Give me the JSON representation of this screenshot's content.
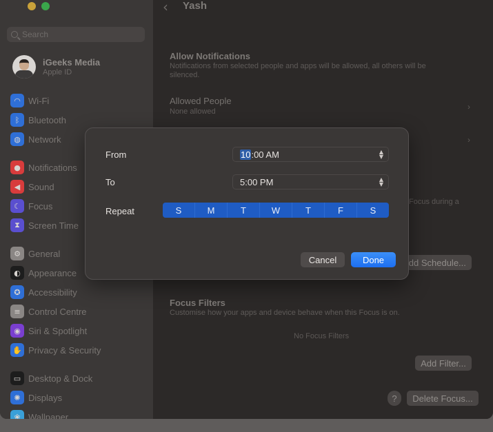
{
  "window": {
    "title": "Yash",
    "back_glyph": "‹"
  },
  "sidebar": {
    "search_placeholder": "Search",
    "account": {
      "name": "iGeeks Media",
      "subtitle": "Apple ID"
    },
    "items": [
      {
        "label": "Wi-Fi",
        "icon": "wifi-icon",
        "glyph": "◠",
        "color": "#2f6fd6"
      },
      {
        "label": "Bluetooth",
        "icon": "bluetooth-icon",
        "glyph": "ᛒ",
        "color": "#2f6fd6"
      },
      {
        "label": "Network",
        "icon": "globe-icon",
        "glyph": "◍",
        "color": "#2f6fd6"
      },
      {
        "label": "Notifications",
        "icon": "bell-icon",
        "glyph": "●",
        "color": "#d83c3c"
      },
      {
        "label": "Sound",
        "icon": "speaker-icon",
        "glyph": "◀",
        "color": "#d83c3c"
      },
      {
        "label": "Focus",
        "icon": "moon-icon",
        "glyph": "☾",
        "color": "#5a4fcf"
      },
      {
        "label": "Screen Time",
        "icon": "hourglass-icon",
        "glyph": "⧗",
        "color": "#5a4fcf"
      },
      {
        "label": "General",
        "icon": "gear-icon",
        "glyph": "⚙",
        "color": "#8a8684"
      },
      {
        "label": "Appearance",
        "icon": "appearance-icon",
        "glyph": "◐",
        "color": "#1d1d1d"
      },
      {
        "label": "Accessibility",
        "icon": "accessibility-icon",
        "glyph": "✪",
        "color": "#2f6fd6"
      },
      {
        "label": "Control Centre",
        "icon": "toggles-icon",
        "glyph": "≡",
        "color": "#8a8684"
      },
      {
        "label": "Siri & Spotlight",
        "icon": "siri-icon",
        "glyph": "◉",
        "color": "#7a3fd0"
      },
      {
        "label": "Privacy & Security",
        "icon": "hand-icon",
        "glyph": "✋",
        "color": "#2f6fd6"
      },
      {
        "label": "Desktop & Dock",
        "icon": "dock-icon",
        "glyph": "▭",
        "color": "#1d1d1d"
      },
      {
        "label": "Displays",
        "icon": "sun-icon",
        "glyph": "✺",
        "color": "#2f6fd6"
      },
      {
        "label": "Wallpaper",
        "icon": "wallpaper-icon",
        "glyph": "❀",
        "color": "#3aa0d8"
      }
    ]
  },
  "main": {
    "allow_notifications": {
      "title": "Allow Notifications",
      "subtitle": "Notifications from selected people and apps will be allowed, all others will be silenced."
    },
    "allowed_people": {
      "title": "Allowed People",
      "subtitle": "None allowed"
    },
    "partial_text": "Focus during a",
    "add_schedule_label": "Add Schedule...",
    "focus_filters": {
      "title": "Focus Filters",
      "subtitle": "Customise how your apps and device behave when this Focus is on.",
      "empty": "No Focus Filters"
    },
    "add_filter_label": "Add Filter...",
    "help_label": "?",
    "delete_focus_label": "Delete Focus..."
  },
  "dialog": {
    "from_label": "From",
    "from_hour": "10",
    "from_rest": ":00 AM",
    "to_label": "To",
    "to_value": "5:00 PM",
    "repeat_label": "Repeat",
    "days": [
      "S",
      "M",
      "T",
      "W",
      "T",
      "F",
      "S"
    ],
    "cancel_label": "Cancel",
    "done_label": "Done"
  },
  "colors": {
    "accent": "#1d6ff0",
    "days_selected": "#1f5cc4"
  }
}
